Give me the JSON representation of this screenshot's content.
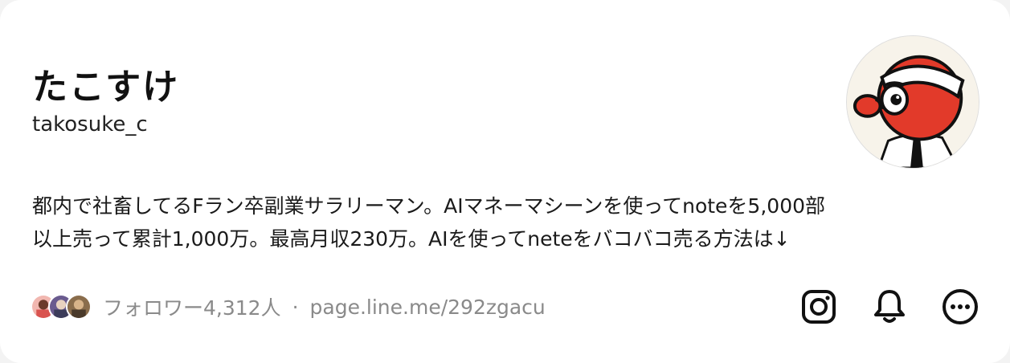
{
  "profile": {
    "name": "たこすけ",
    "handle": "takosuke_c",
    "avatar_icon": "octopus-mascot-avatar",
    "bio_lines": [
      "都内で社畜してるFラン卒副業サラリーマン。AIマネーマシーンを使ってnoteを5,000部",
      "以上売って累計1,000万。最高月収230万。AIを使ってneteをバコバコ売る方法は↓"
    ]
  },
  "meta": {
    "followers_label": "フォロワー4,312人",
    "separator": "·",
    "link": "page.line.me/292zgacu"
  },
  "actions": {
    "instagram_icon": "instagram-icon",
    "notification_icon": "bell-icon",
    "more_icon": "more-icon"
  },
  "colors": {
    "accent_red": "#e23a2a",
    "meta_gray": "#8a8a8a"
  }
}
